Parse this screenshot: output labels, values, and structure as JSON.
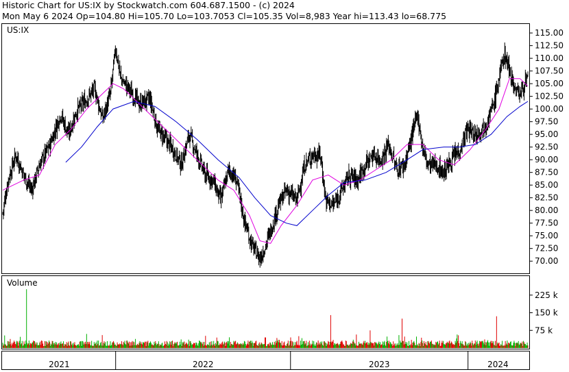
{
  "header": {
    "line1": "Historic Chart for US:IX by Stockwatch.com 604.687.1500 - (c) 2024",
    "line2": "Mon May  6 2024   Op=104.80  Hi=105.70  Lo=103.7053  Cl=105.35   Vol=8,983   Year hi=113.43   lo=68.775"
  },
  "price_panel": {
    "label": "US:IX"
  },
  "volume_panel": {
    "label": "Volume"
  },
  "colors": {
    "price_bars": "#000000",
    "ma_short": "#e000e0",
    "ma_long": "#0000cc",
    "vol_up": "#00b000",
    "vol_down": "#e00000"
  },
  "chart_data": [
    {
      "type": "line",
      "subtype": "ohlc-price-with-moving-averages",
      "x_axis": {
        "years": [
          "2021",
          "2022",
          "2023",
          "2024"
        ]
      },
      "y_axis": {
        "ticks": [
          "115.00",
          "112.50",
          "110.00",
          "107.50",
          "105.00",
          "102.50",
          "100.00",
          "97.50",
          "95.00",
          "92.50",
          "90.00",
          "87.50",
          "85.00",
          "82.50",
          "80.00",
          "77.50",
          "75.00",
          "72.50",
          "70.00"
        ],
        "ylim": [
          68.0,
          116.5
        ],
        "position": "right"
      },
      "series": [
        {
          "role": "close",
          "points": [
            [
              0.0,
              79.5
            ],
            [
              0.01,
              86
            ],
            [
              0.025,
              91
            ],
            [
              0.04,
              87
            ],
            [
              0.055,
              84
            ],
            [
              0.07,
              89
            ],
            [
              0.09,
              93
            ],
            [
              0.11,
              99
            ],
            [
              0.125,
              95
            ],
            [
              0.14,
              99.5
            ],
            [
              0.16,
              102
            ],
            [
              0.175,
              104
            ],
            [
              0.19,
              98
            ],
            [
              0.205,
              103
            ],
            [
              0.215,
              112
            ],
            [
              0.225,
              106
            ],
            [
              0.24,
              104
            ],
            [
              0.26,
              101
            ],
            [
              0.28,
              102
            ],
            [
              0.295,
              96
            ],
            [
              0.31,
              94
            ],
            [
              0.325,
              92
            ],
            [
              0.34,
              89
            ],
            [
              0.355,
              95
            ],
            [
              0.37,
              91
            ],
            [
              0.385,
              87
            ],
            [
              0.4,
              86
            ],
            [
              0.415,
              82
            ],
            [
              0.43,
              88
            ],
            [
              0.445,
              86
            ],
            [
              0.46,
              78
            ],
            [
              0.475,
              73
            ],
            [
              0.49,
              70.5
            ],
            [
              0.5,
              73
            ],
            [
              0.51,
              76
            ],
            [
              0.525,
              81
            ],
            [
              0.54,
              84
            ],
            [
              0.56,
              82
            ],
            [
              0.575,
              89
            ],
            [
              0.59,
              91
            ],
            [
              0.605,
              91
            ],
            [
              0.615,
              82
            ],
            [
              0.63,
              81
            ],
            [
              0.645,
              84
            ],
            [
              0.66,
              87
            ],
            [
              0.675,
              86
            ],
            [
              0.69,
              89
            ],
            [
              0.705,
              91
            ],
            [
              0.72,
              90
            ],
            [
              0.735,
              93
            ],
            [
              0.75,
              88
            ],
            [
              0.765,
              89
            ],
            [
              0.78,
              95
            ],
            [
              0.79,
              99
            ],
            [
              0.8,
              92
            ],
            [
              0.81,
              89
            ],
            [
              0.825,
              89
            ],
            [
              0.84,
              87.5
            ],
            [
              0.855,
              90
            ],
            [
              0.87,
              92
            ],
            [
              0.885,
              96
            ],
            [
              0.9,
              95
            ],
            [
              0.92,
              97
            ],
            [
              0.935,
              101
            ],
            [
              0.945,
              106
            ],
            [
              0.955,
              111
            ],
            [
              0.965,
              108
            ],
            [
              0.975,
              104
            ],
            [
              0.985,
              103
            ],
            [
              0.995,
              105.35
            ]
          ]
        },
        {
          "role": "ma_short",
          "points": [
            [
              0.0,
              84
            ],
            [
              0.04,
              86
            ],
            [
              0.07,
              87
            ],
            [
              0.1,
              93
            ],
            [
              0.13,
              96
            ],
            [
              0.16,
              100
            ],
            [
              0.19,
              103
            ],
            [
              0.21,
              105
            ],
            [
              0.23,
              104
            ],
            [
              0.26,
              101
            ],
            [
              0.29,
              98
            ],
            [
              0.32,
              95
            ],
            [
              0.35,
              92
            ],
            [
              0.38,
              89
            ],
            [
              0.41,
              86
            ],
            [
              0.44,
              84
            ],
            [
              0.47,
              79
            ],
            [
              0.49,
              74
            ],
            [
              0.51,
              73.5
            ],
            [
              0.53,
              77
            ],
            [
              0.56,
              81
            ],
            [
              0.59,
              86
            ],
            [
              0.62,
              87
            ],
            [
              0.65,
              85
            ],
            [
              0.68,
              86
            ],
            [
              0.71,
              88
            ],
            [
              0.74,
              90
            ],
            [
              0.77,
              93
            ],
            [
              0.8,
              93
            ],
            [
              0.83,
              90
            ],
            [
              0.86,
              89
            ],
            [
              0.89,
              92
            ],
            [
              0.92,
              96
            ],
            [
              0.945,
              100
            ],
            [
              0.965,
              106
            ],
            [
              0.985,
              106
            ],
            [
              1.0,
              104.5
            ]
          ]
        },
        {
          "role": "ma_long",
          "points": [
            [
              0.12,
              89.5
            ],
            [
              0.15,
              92.5
            ],
            [
              0.18,
              96.5
            ],
            [
              0.21,
              100
            ],
            [
              0.25,
              101.5
            ],
            [
              0.29,
              100.5
            ],
            [
              0.33,
              97.5
            ],
            [
              0.37,
              94
            ],
            [
              0.41,
              90
            ],
            [
              0.45,
              86.5
            ],
            [
              0.48,
              82.5
            ],
            [
              0.51,
              79
            ],
            [
              0.54,
              77.5
            ],
            [
              0.56,
              77
            ],
            [
              0.59,
              80
            ],
            [
              0.62,
              83
            ],
            [
              0.65,
              85.5
            ],
            [
              0.69,
              86
            ],
            [
              0.73,
              87.5
            ],
            [
              0.77,
              90
            ],
            [
              0.8,
              92
            ],
            [
              0.84,
              92.5
            ],
            [
              0.87,
              92.5
            ],
            [
              0.9,
              93
            ],
            [
              0.93,
              95
            ],
            [
              0.96,
              98.5
            ],
            [
              0.985,
              100.5
            ],
            [
              1.0,
              101.5
            ]
          ]
        }
      ]
    },
    {
      "type": "bar",
      "subtype": "volume",
      "y_axis": {
        "ticks": [
          "225 k",
          "150 k",
          "75 k"
        ],
        "ylim": [
          0,
          300
        ]
      },
      "spikes": [
        [
          0.045,
          250
        ],
        [
          0.16,
          60
        ],
        [
          0.19,
          55
        ],
        [
          0.5,
          45
        ],
        [
          0.625,
          140
        ],
        [
          0.7,
          75
        ],
        [
          0.76,
          125
        ],
        [
          0.94,
          135
        ]
      ]
    }
  ]
}
